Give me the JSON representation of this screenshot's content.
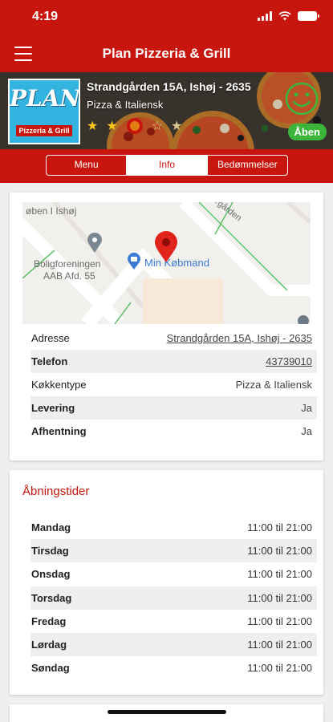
{
  "status_bar": {
    "time": "4:19"
  },
  "nav": {
    "title": "Plan Pizzeria & Grill"
  },
  "restaurant": {
    "logo_text": "PLAN",
    "logo_subtitle": "Pizzeria & Grill",
    "address": "Strandgården 15A, Ishøj - 2635",
    "cuisine": "Pizza & Italiensk",
    "status_badge": "Åben",
    "rating_stars": 2
  },
  "tabs": [
    {
      "label": "Menu",
      "active": false
    },
    {
      "label": "Info",
      "active": true
    },
    {
      "label": "Bedømmelser",
      "active": false
    }
  ],
  "map": {
    "labels": [
      "øben I Ishøj",
      "Boligforeningen",
      "AAB Afd. 55",
      "Min Købmand",
      "ergården"
    ]
  },
  "info": [
    {
      "key": "Adresse",
      "value": "Strandgården 15A, Ishøj - 2635"
    },
    {
      "key": "Telefon",
      "value": "43739010"
    },
    {
      "key": "Køkkentype",
      "value": "Pizza & Italiensk"
    },
    {
      "key": "Levering",
      "value": "Ja"
    },
    {
      "key": "Afhentning",
      "value": "Ja"
    }
  ],
  "hours": {
    "title": "Åbningstider",
    "days": [
      {
        "day": "Mandag",
        "time": "11:00 til 21:00"
      },
      {
        "day": "Tirsdag",
        "time": "11:00 til 21:00"
      },
      {
        "day": "Onsdag",
        "time": "11:00 til 21:00"
      },
      {
        "day": "Torsdag",
        "time": "11:00 til 21:00"
      },
      {
        "day": "Fredag",
        "time": "11:00 til 21:00"
      },
      {
        "day": "Lørdag",
        "time": "11:00 til 21:00"
      },
      {
        "day": "Søndag",
        "time": "11:00 til 21:00"
      }
    ]
  },
  "colors": {
    "brand_red": "#c8160e",
    "open_green": "#3bb63b",
    "smiley_green": "#3bb63b",
    "star_gold": "#f5c518"
  }
}
